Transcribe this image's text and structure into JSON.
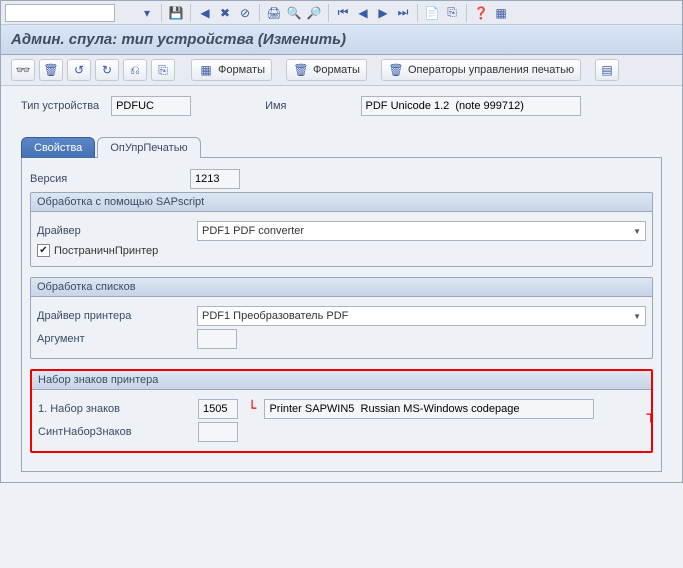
{
  "title": "Админ. спула: тип устройства (Изменить)",
  "toolbar_buttons": {
    "formats1": "Форматы",
    "formats2": "Форматы",
    "print_ops": "Операторы управления печатью"
  },
  "header": {
    "device_type_label": "Тип устройства",
    "device_type_value": "PDFUC",
    "name_label": "Имя",
    "name_value": "PDF Unicode 1.2  (note 999712)"
  },
  "tabs": {
    "props": "Свойства",
    "printops": "ОпУпрПечатью"
  },
  "panel": {
    "version_label": "Версия",
    "version_value": "1213",
    "sapscript_header": "Обработка с помощью SAPscript",
    "driver_label": "Драйвер",
    "driver_value": "PDF1 PDF converter",
    "page_printer_label": "ПостраничнПринтер",
    "lists_header": "Обработка списков",
    "printer_driver_label": "Драйвер принтера",
    "printer_driver_value": "PDF1 Преобразователь PDF",
    "argument_label": "Аргумент",
    "argument_value": "",
    "charset_header": "Набор знаков принтера",
    "charset_row_label": "1.  Набор знаков",
    "charset_code": "1505",
    "charset_desc": "Printer SAPWIN5  Russian MS-Windows codepage",
    "synt_label": "СинтНаборЗнаков",
    "synt_value": ""
  }
}
